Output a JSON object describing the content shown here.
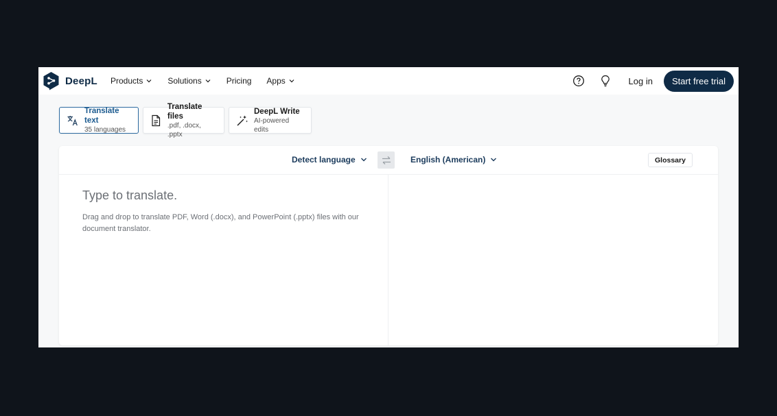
{
  "brand": {
    "name": "DeepL"
  },
  "nav": {
    "items": [
      {
        "label": "Products",
        "has_dropdown": true
      },
      {
        "label": "Solutions",
        "has_dropdown": true
      },
      {
        "label": "Pricing",
        "has_dropdown": false
      },
      {
        "label": "Apps",
        "has_dropdown": true
      }
    ],
    "login_label": "Log in",
    "trial_label": "Start free trial",
    "icons": [
      "help-circle-icon",
      "lightbulb-icon"
    ]
  },
  "modes": [
    {
      "title": "Translate text",
      "subtitle": "35 languages",
      "icon": "translate-icon",
      "active": true
    },
    {
      "title": "Translate files",
      "subtitle": ".pdf, .docx, .pptx",
      "icon": "document-icon",
      "active": false
    },
    {
      "title": "DeepL Write",
      "subtitle": "AI-powered edits",
      "icon": "magic-wand-icon",
      "active": false
    }
  ],
  "translator": {
    "source_language": "Detect language",
    "target_language": "English (American)",
    "glossary_label": "Glossary",
    "source_placeholder": "Type to translate.",
    "source_value": "",
    "drop_hint": "Drag and drop to translate PDF, Word (.docx), and PowerPoint (.pptx) files with our document translator."
  },
  "colors": {
    "brand_navy": "#0f2b46",
    "active_tab_border": "#2c6aa0",
    "language_text": "#1b3b5c",
    "outer_background": "#0f141b"
  }
}
